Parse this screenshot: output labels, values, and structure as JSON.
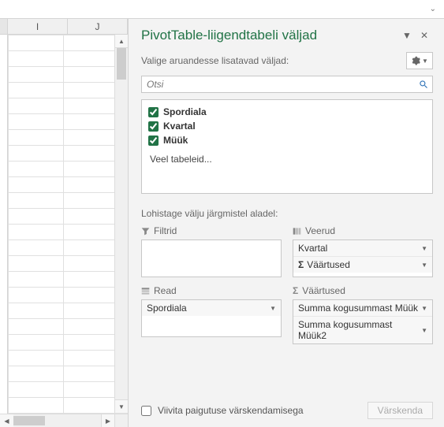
{
  "spreadsheet": {
    "columns": [
      "I",
      "J"
    ]
  },
  "pane": {
    "title": "PivotTable-liigendtabeli väljad",
    "choose_label": "Valige aruandesse lisatavad väljad:",
    "search_placeholder": "Otsi",
    "fields": [
      {
        "label": "Spordiala",
        "checked": true
      },
      {
        "label": "Kvartal",
        "checked": true
      },
      {
        "label": "Müük",
        "checked": true
      }
    ],
    "more_tables": "Veel tabeleid...",
    "drag_label": "Lohistage välju järgmistel aladel:",
    "areas": {
      "filters": {
        "title": "Filtrid",
        "items": []
      },
      "columns": {
        "title": "Veerud",
        "items": [
          {
            "label": "Kvartal",
            "prefix": ""
          },
          {
            "label": "Väärtused",
            "prefix": "Σ"
          }
        ]
      },
      "rows": {
        "title": "Read",
        "items": [
          {
            "label": "Spordiala",
            "prefix": ""
          }
        ]
      },
      "values": {
        "title": "Väärtused",
        "items": [
          {
            "label": "Summa kogusummast Müük",
            "prefix": ""
          },
          {
            "label": "Summa kogusummast Müük2",
            "prefix": ""
          }
        ]
      }
    },
    "defer_label": "Viivita paigutuse värskendamisega",
    "refresh_label": "Värskenda"
  }
}
